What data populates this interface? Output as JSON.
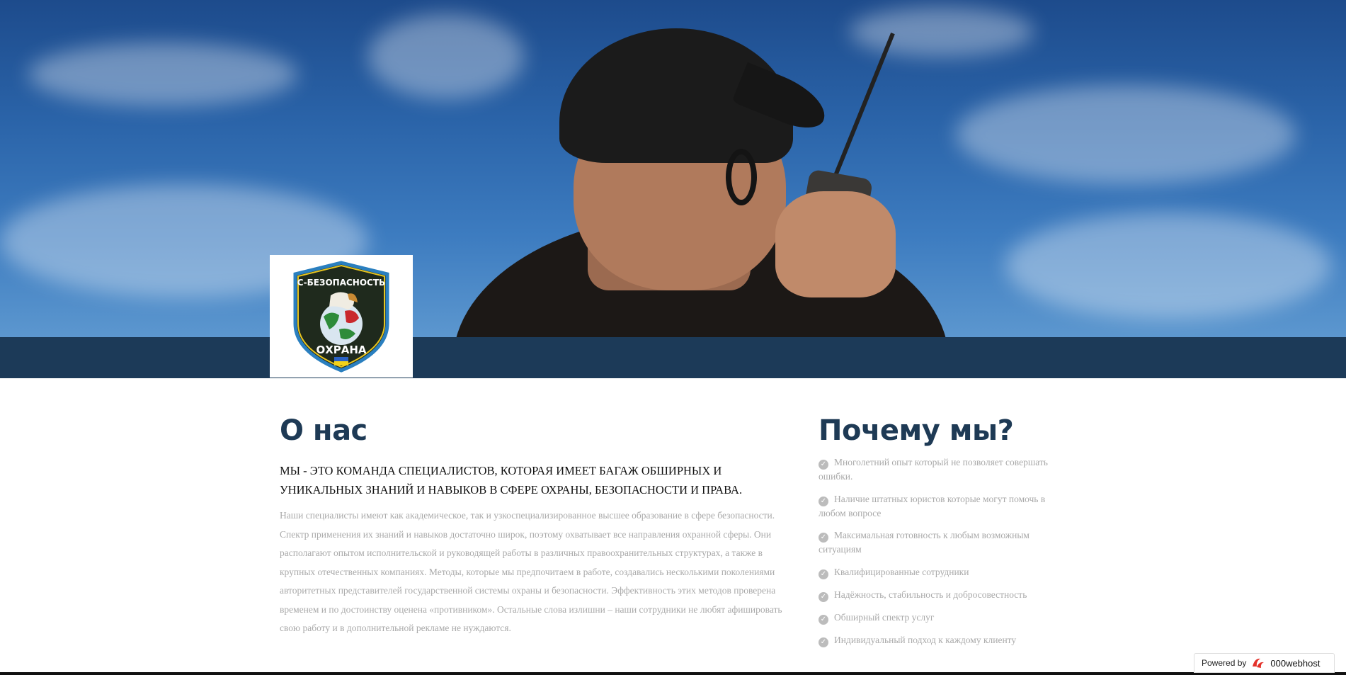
{
  "logo": {
    "top_text": "С-БЕЗОПАСНОСТЬ",
    "bottom_text": "ОХРАНА"
  },
  "about": {
    "title": "О нас",
    "lead": "МЫ - ЭТО  КОМАНДА СПЕЦИАЛИСТОВ, КОТОРАЯ ИМЕЕТ БАГАЖ ОБШИРНЫХ И УНИКАЛЬНЫХ ЗНАНИЙ И НАВЫКОВ В СФЕРЕ ОХРАНЫ, БЕЗОПАСНОСТИ И ПРАВА.",
    "body": "Наши специалисты имеют как академическое, так и узкоспециализированное  высшее образование в сфере безопасности. Спектр применения их знаний и навыков достаточно широк, поэтому охватывает все направления охранной сферы. Они располагают опытом исполнительской и руководящей работы в различных правоохранительных структурах, а также в крупных отечественных компаниях. Методы, которые мы предпочитаем в работе, создавались несколькими поколениями авторитетных представителей государственной системы охраны и безопасности. Эффективность этих методов проверена временем и по достоинству оценена «противником». Остальные слова излишни – наши сотрудники не любят афишировать свою работу и в дополнительной рекламе не нуждаются."
  },
  "why": {
    "title": "Почему мы?",
    "items": [
      "Многолетний опыт который не позволяет совершать ошибки.",
      "Наличие штатных юристов которые могут помочь в любом вопросе",
      "Максимальная готовность к любым возможным ситуациям",
      "Квалифицированные сотрудники",
      "Надёжность, стабильность и добросовестность",
      "Обширный спектр услуг",
      "Индивидуальный подход к каждому клиенту"
    ],
    "bullet_icon": "check-circle-icon"
  },
  "powered": {
    "label": "Powered by",
    "brand": "000webhost",
    "icon": "000webhost-logo-icon"
  },
  "colors": {
    "heading": "#1e3a55",
    "bar": "#1c3a58",
    "muted_text": "#a9a9a9"
  }
}
